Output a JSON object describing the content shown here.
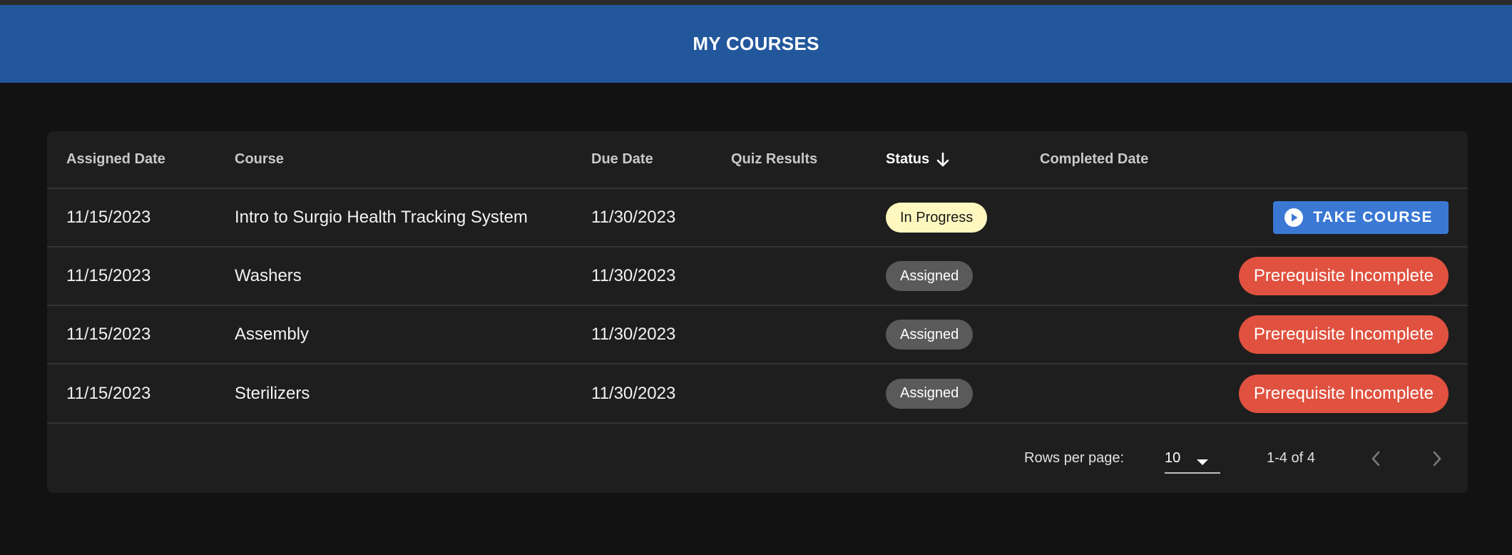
{
  "header": {
    "title": "MY COURSES"
  },
  "table": {
    "columns": {
      "assigned_date": "Assigned Date",
      "course": "Course",
      "due_date": "Due Date",
      "quiz_results": "Quiz Results",
      "status": "Status",
      "completed_date": "Completed Date"
    },
    "sort": {
      "column": "Status",
      "direction": "descending",
      "icon": "arrow-down-icon"
    },
    "rows": [
      {
        "assigned_date": "11/15/2023",
        "course": "Intro to Surgio Health Tracking System",
        "due_date": "11/30/2023",
        "quiz_results": "",
        "status": "In Progress",
        "completed_date": "",
        "action": "TAKE COURSE"
      },
      {
        "assigned_date": "11/15/2023",
        "course": "Washers",
        "due_date": "11/30/2023",
        "quiz_results": "",
        "status": "Assigned",
        "completed_date": "",
        "action": "Prerequisite Incomplete"
      },
      {
        "assigned_date": "11/15/2023",
        "course": "Assembly",
        "due_date": "11/30/2023",
        "quiz_results": "",
        "status": "Assigned",
        "completed_date": "",
        "action": "Prerequisite Incomplete"
      },
      {
        "assigned_date": "11/15/2023",
        "course": "Sterilizers",
        "due_date": "11/30/2023",
        "quiz_results": "",
        "status": "Assigned",
        "completed_date": "",
        "action": "Prerequisite Incomplete"
      }
    ]
  },
  "pagination": {
    "rows_per_page_label": "Rows per page:",
    "rows_per_page_value": "10",
    "range_text": "1-4 of 4"
  },
  "colors": {
    "header_bg": "#22579c",
    "page_bg": "#121212",
    "card_bg": "#1e1e1e",
    "in_progress_chip": "#fff7c0",
    "assigned_chip": "#5a5a5a",
    "take_course_button": "#3a78d4",
    "prerequisite_button": "#e0513f"
  },
  "icons": {
    "take_course": "play-circle-icon",
    "rows_select": "caret-down-icon",
    "prev_page": "chevron-left-icon",
    "next_page": "chevron-right-icon"
  }
}
